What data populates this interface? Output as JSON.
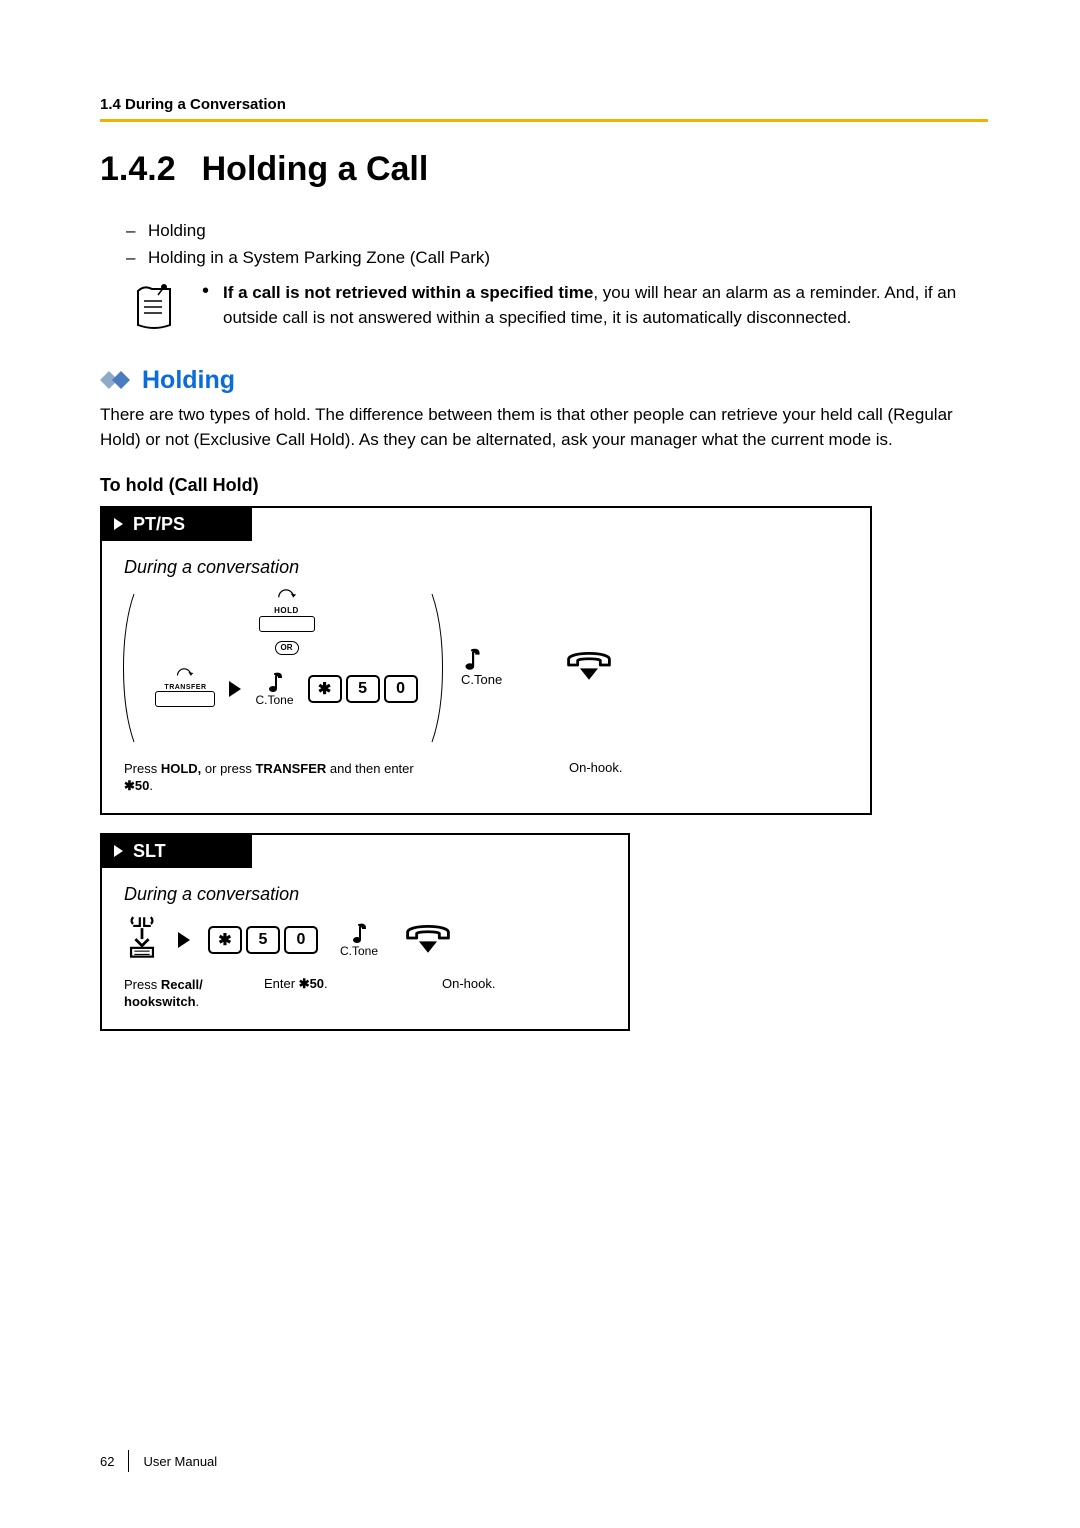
{
  "breadcrumb": "1.4 During a Conversation",
  "heading": {
    "number": "1.4.2",
    "title": "Holding a Call"
  },
  "toc": [
    "Holding",
    "Holding in a System Parking Zone (Call Park)"
  ],
  "note": {
    "bold_lead": "If a call is not retrieved within a specified time",
    "rest": ", you will hear an alarm as a reminder. And, if an outside call is not answered within a specified time, it is automatically disconnected."
  },
  "section2_title": "Holding",
  "section2_body": "There are two types of hold. The difference between them is that other people can retrieve your held call (Regular Hold) or not (Exclusive Call Hold). As they can be alternated, ask your manager what the current mode is.",
  "h3": "To hold (Call Hold)",
  "ptps": {
    "tab": "PT/PS",
    "subtitle": "During a conversation",
    "hold_label": "HOLD",
    "or_label": "OR",
    "transfer_label": "TRANSFER",
    "keys": [
      "✱",
      "5",
      "0"
    ],
    "ctone_inner": "C.Tone",
    "ctone_outer": "C.Tone",
    "caption_left_pre": "Press ",
    "caption_left_b1": "HOLD,",
    "caption_left_mid": " or press ",
    "caption_left_b2": "TRANSFER",
    "caption_left_post": " and then enter ",
    "caption_left_code": "✱50",
    "caption_left_end": ".",
    "caption_right": "On-hook."
  },
  "slt": {
    "tab": "SLT",
    "subtitle": "During a conversation",
    "keys": [
      "✱",
      "5",
      "0"
    ],
    "ctone": "C.Tone",
    "cap_a_pre": "Press ",
    "cap_a_b": "Recall/ hookswitch",
    "cap_a_end": ".",
    "cap_b_pre": "Enter ",
    "cap_b_code": "✱50",
    "cap_b_end": ".",
    "cap_c": "On-hook."
  },
  "footer": {
    "page": "62",
    "label": "User Manual"
  }
}
